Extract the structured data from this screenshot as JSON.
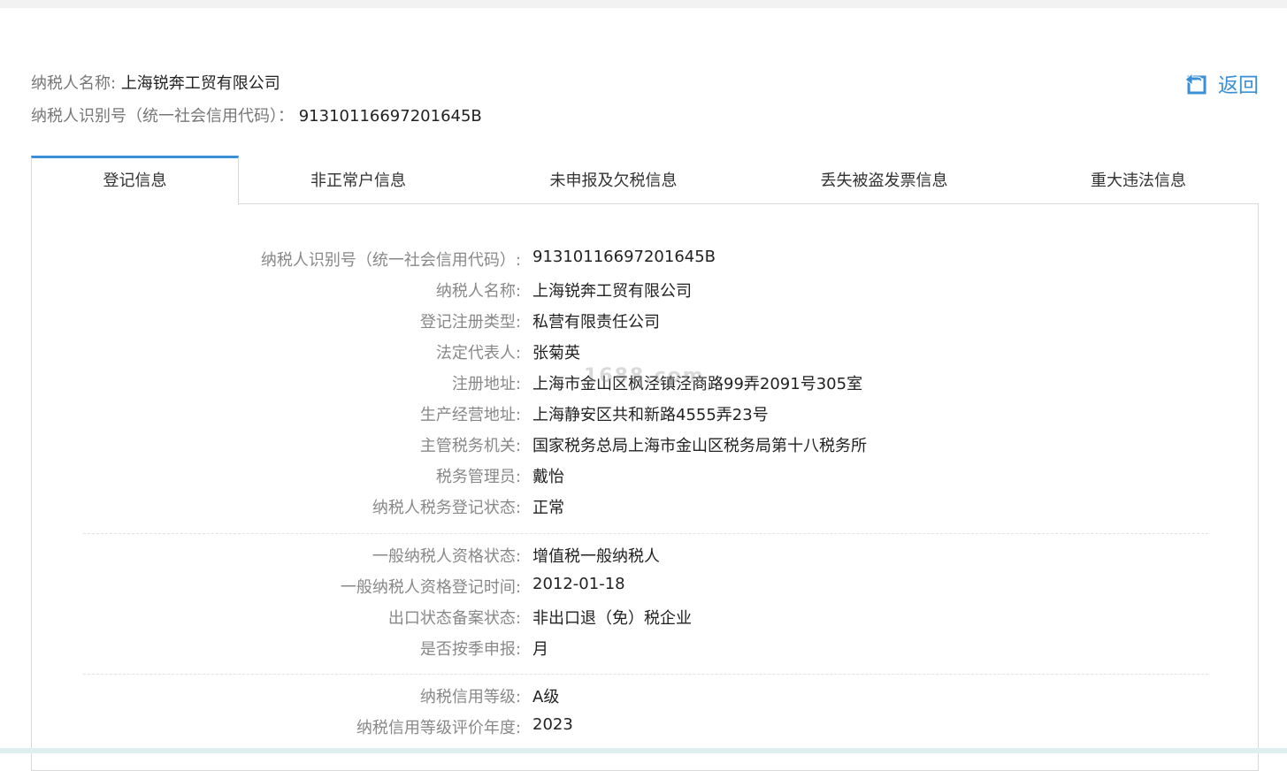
{
  "header": {
    "name_label": "纳税人名称:",
    "name_value": "上海锐奔工贸有限公司",
    "id_label": "纳税人识别号（统一社会信用代码）：",
    "id_value": "91310116697201645B",
    "back_label": "返回"
  },
  "tabs": [
    {
      "label": "登记信息",
      "active": true
    },
    {
      "label": "非正常户信息",
      "active": false
    },
    {
      "label": "未申报及欠税信息",
      "active": false
    },
    {
      "label": "丢失被盗发票信息",
      "active": false
    },
    {
      "label": "重大违法信息",
      "active": false
    }
  ],
  "registration": {
    "group1": [
      {
        "key": "纳税人识别号（统一社会信用代码）:",
        "value": "91310116697201645B"
      },
      {
        "key": "纳税人名称:",
        "value": "上海锐奔工贸有限公司"
      },
      {
        "key": "登记注册类型:",
        "value": "私营有限责任公司"
      },
      {
        "key": "法定代表人:",
        "value": "张菊英"
      },
      {
        "key": "注册地址:",
        "value": "上海市金山区枫泾镇泾商路99弄2091号305室"
      },
      {
        "key": "生产经营地址:",
        "value": "上海静安区共和新路4555弄23号"
      },
      {
        "key": "主管税务机关:",
        "value": "国家税务总局上海市金山区税务局第十八税务所"
      },
      {
        "key": "税务管理员:",
        "value": "戴怡"
      },
      {
        "key": "纳税人税务登记状态:",
        "value": "正常"
      }
    ],
    "group2": [
      {
        "key": "一般纳税人资格状态:",
        "value": "增值税一般纳税人"
      },
      {
        "key": "一般纳税人资格登记时间:",
        "value": "2012-01-18"
      },
      {
        "key": "出口状态备案状态:",
        "value": "非出口退（免）税企业"
      },
      {
        "key": "是否按季申报:",
        "value": "月"
      }
    ],
    "group3": [
      {
        "key": "纳税信用等级:",
        "value": "A级"
      },
      {
        "key": "纳税信用等级评价年度:",
        "value": "2023"
      }
    ]
  },
  "watermark": "1688.com",
  "colors": {
    "accent": "#3a8fd6",
    "label": "#888888",
    "text": "#222222",
    "border": "#d9d9d9"
  }
}
